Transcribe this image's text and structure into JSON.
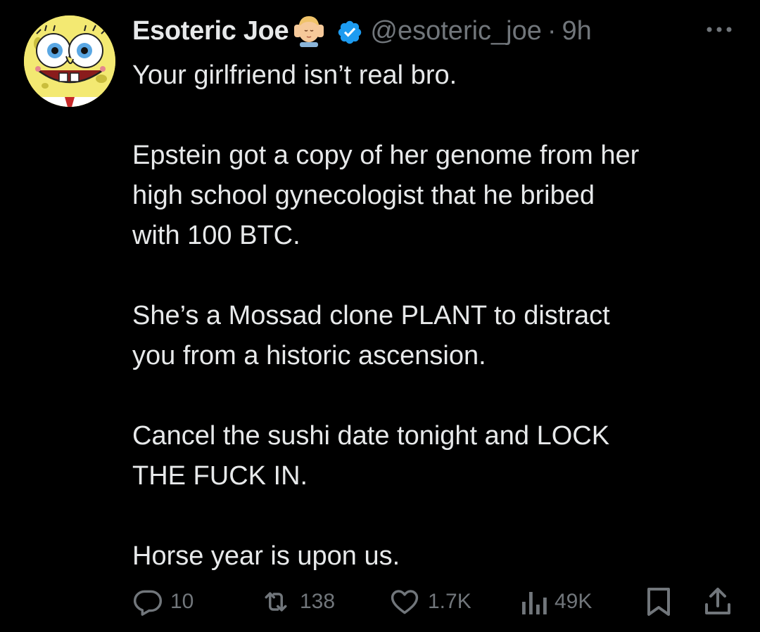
{
  "tweet": {
    "display_name": "Esoteric Joe",
    "handle": "@esoteric_joe",
    "separator": "·",
    "time": "9h",
    "body_lines": [
      "Your girlfriend isn’t real bro.",
      "",
      "Epstein got a copy of her genome from her",
      "high school gynecologist that he bribed",
      "with 100 BTC.",
      "",
      "She’s a Mossad clone PLANT to distract",
      "you from a historic ascension.",
      "",
      "Cancel the sushi date tonight and LOCK",
      "THE FUCK IN.",
      "",
      "Horse year is upon us."
    ],
    "name_emoji": "massage-emoji",
    "verified_icon": "verified-badge-icon",
    "more_icon": "more-options-icon"
  },
  "actions": {
    "replies": "10",
    "reposts": "138",
    "likes": "1.7K",
    "views": "49K",
    "reply_icon": "reply-icon",
    "repost_icon": "repost-icon",
    "like_icon": "heart-icon",
    "views_icon": "views-chart-icon",
    "bookmark_icon": "bookmark-icon",
    "share_icon": "share-icon"
  },
  "colors": {
    "background": "#000000",
    "text_primary": "#e7e9ea",
    "text_secondary": "#71767b",
    "verified_blue": "#1d9bf0"
  }
}
